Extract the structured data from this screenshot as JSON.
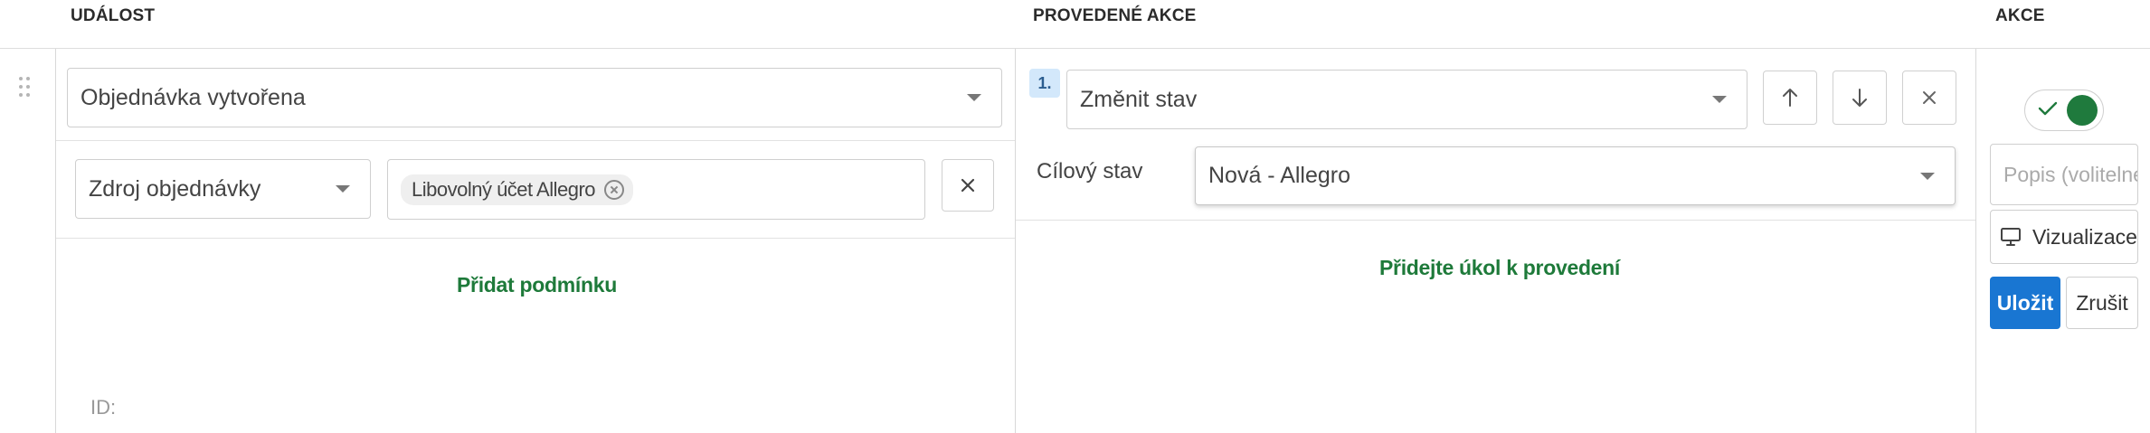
{
  "headers": {
    "event": "UDÁLOST",
    "actions_done": "PROVEDENÉ AKCE",
    "actions": "AKCE"
  },
  "event": {
    "trigger_select": {
      "value": "Objednávka vytvořena",
      "icon": "caret-down-icon"
    },
    "condition": {
      "field_select": "Zdroj objednávky",
      "tags": [
        "Libovolný účet Allegro"
      ]
    },
    "add_condition_label": "Přidat podmínku",
    "id_label": "ID:"
  },
  "actions_done": {
    "step_number": "1.",
    "action_select": "Změnit stav",
    "target_state_label": "Cílový stav",
    "target_state_value": "Nová - Allegro",
    "add_task_label": "Přidejte úkol k provedení",
    "icons": [
      "arrow-up-icon",
      "arrow-down-icon",
      "close-icon"
    ]
  },
  "actions": {
    "toggle_enabled": true,
    "description_placeholder": "Popis (volitelné)",
    "visualize_label": "Vizualizace",
    "save_label": "Uložit",
    "cancel_label": "Zrušit"
  },
  "colors": {
    "accent_green": "#1e7a3a",
    "primary_blue": "#1976d2",
    "badge_bg": "#d3e8fb"
  }
}
